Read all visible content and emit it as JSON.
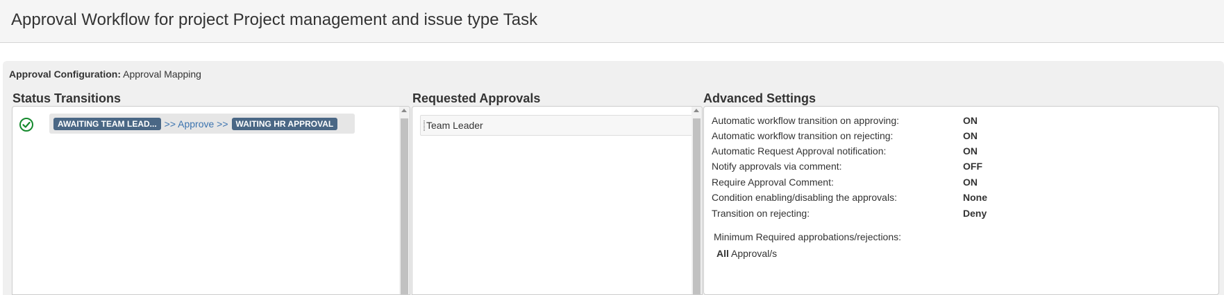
{
  "page": {
    "title": "Approval Workflow for project Project management and issue type Task"
  },
  "config": {
    "label": "Approval Configuration:",
    "value": "Approval Mapping"
  },
  "status_transitions": {
    "heading": "Status Transitions",
    "items": [
      {
        "from": "AWAITING TEAM LEAD...",
        "action": ">> Approve >>",
        "to": "WAITING HR APPROVAL",
        "icon": "check-circle-icon"
      }
    ]
  },
  "requested_approvals": {
    "heading": "Requested Approvals",
    "items": [
      "Team Leader"
    ]
  },
  "advanced_settings": {
    "heading": "Advanced Settings",
    "rows": [
      {
        "label": "Automatic workflow transition on approving:",
        "value": "ON"
      },
      {
        "label": "Automatic workflow transition on rejecting:",
        "value": "ON"
      },
      {
        "label": "Automatic Request Approval notification:",
        "value": "ON"
      },
      {
        "label": "Notify approvals via comment:",
        "value": "OFF"
      },
      {
        "label": "Require Approval Comment:",
        "value": "ON"
      },
      {
        "label": "Condition enabling/disabling the approvals:",
        "value": "None"
      },
      {
        "label": "Transition on rejecting:",
        "value": "Deny"
      }
    ],
    "minimum_label": "Minimum Required approbations/rejections:",
    "minimum_value_bold": "All",
    "minimum_value_rest": " Approval/s"
  },
  "colors": {
    "lozenge": "#4a6785",
    "link": "#3b73af",
    "check": "#14892c"
  }
}
